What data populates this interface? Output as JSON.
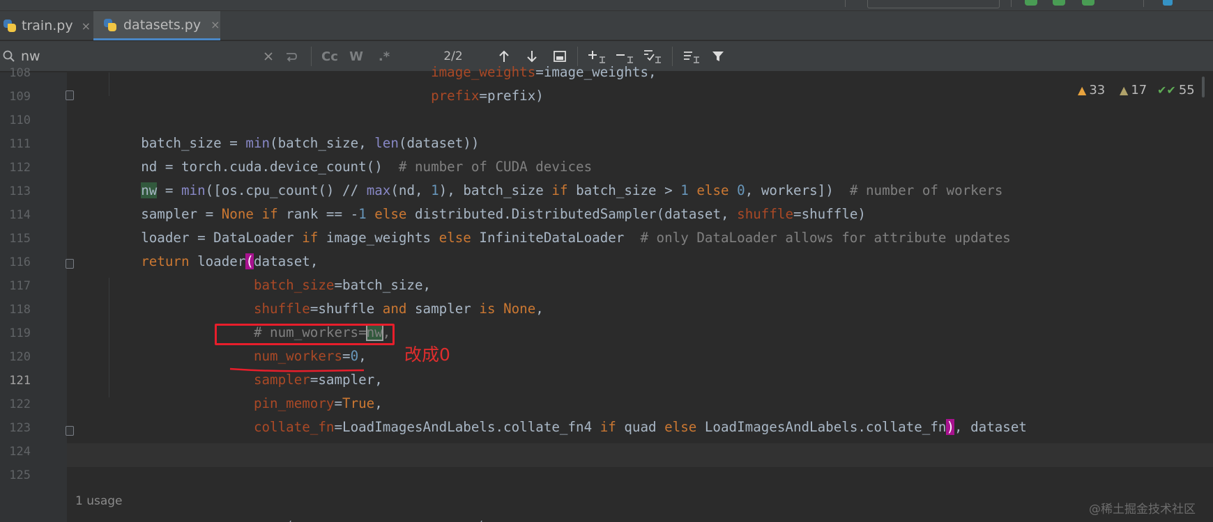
{
  "tabs": [
    {
      "label": "train.py",
      "close": "×"
    },
    {
      "label": "datasets.py",
      "close": "×"
    }
  ],
  "find": {
    "query": "nw",
    "match_count": "2/2",
    "opt_case": "Cc",
    "opt_words": "W",
    "opt_regex": ".*"
  },
  "inspections": {
    "warnings": "33",
    "weak_warnings": "17",
    "typos": "55"
  },
  "editor": {
    "current_line": 121,
    "lines": [
      {
        "n": "108",
        "tokens": [
          {
            "t": "                                        "
          },
          {
            "t": "image_weights",
            "c": "pm"
          },
          {
            "t": "=image_weights,"
          }
        ]
      },
      {
        "n": "109",
        "tokens": [
          {
            "t": "                                        "
          },
          {
            "t": "prefix",
            "c": "pm"
          },
          {
            "t": "=prefix)"
          }
        ]
      },
      {
        "n": "110",
        "tokens": []
      },
      {
        "n": "111",
        "tokens": [
          {
            "t": "    batch_size = "
          },
          {
            "t": "min",
            "c": "fn"
          },
          {
            "t": "(batch_size, "
          },
          {
            "t": "len",
            "c": "fn"
          },
          {
            "t": "(dataset))"
          }
        ]
      },
      {
        "n": "112",
        "tokens": [
          {
            "t": "    nd = torch.cuda.device_count()  "
          },
          {
            "t": "# number of CUDA devices",
            "c": "cm"
          }
        ]
      },
      {
        "n": "113",
        "tokens": [
          {
            "t": "    "
          },
          {
            "t": "nw",
            "c": "occ"
          },
          {
            "t": " = "
          },
          {
            "t": "min",
            "c": "fn"
          },
          {
            "t": "([os.cpu_count() // "
          },
          {
            "t": "max",
            "c": "fn"
          },
          {
            "t": "(nd, "
          },
          {
            "t": "1",
            "c": "num"
          },
          {
            "t": "), batch_size "
          },
          {
            "t": "if",
            "c": "kw"
          },
          {
            "t": " batch_size > "
          },
          {
            "t": "1",
            "c": "num"
          },
          {
            "t": " "
          },
          {
            "t": "else",
            "c": "kw"
          },
          {
            "t": " "
          },
          {
            "t": "0",
            "c": "num"
          },
          {
            "t": ", workers])  "
          },
          {
            "t": "# number of workers",
            "c": "cm"
          }
        ]
      },
      {
        "n": "114",
        "tokens": [
          {
            "t": "    sampler = "
          },
          {
            "t": "None",
            "c": "kw"
          },
          {
            "t": " "
          },
          {
            "t": "if",
            "c": "kw"
          },
          {
            "t": " rank == -"
          },
          {
            "t": "1",
            "c": "num"
          },
          {
            "t": " "
          },
          {
            "t": "else",
            "c": "kw"
          },
          {
            "t": " distributed.DistributedSampler(dataset, "
          },
          {
            "t": "shuffle",
            "c": "pm"
          },
          {
            "t": "=shuffle)"
          }
        ]
      },
      {
        "n": "115",
        "tokens": [
          {
            "t": "    loader = DataLoader "
          },
          {
            "t": "if",
            "c": "kw"
          },
          {
            "t": " image_weights "
          },
          {
            "t": "else",
            "c": "kw"
          },
          {
            "t": " InfiniteDataLoader  "
          },
          {
            "t": "# only DataLoader allows for attribute updates",
            "c": "cm"
          }
        ]
      },
      {
        "n": "116",
        "tokens": [
          {
            "t": "    "
          },
          {
            "t": "return",
            "c": "kw"
          },
          {
            "t": " loader"
          },
          {
            "t": "(",
            "c": "brace"
          },
          {
            "t": "dataset,"
          }
        ]
      },
      {
        "n": "117",
        "tokens": [
          {
            "t": "                  "
          },
          {
            "t": "batch_size",
            "c": "pm"
          },
          {
            "t": "=batch_size,"
          }
        ]
      },
      {
        "n": "118",
        "tokens": [
          {
            "t": "                  "
          },
          {
            "t": "shuffle",
            "c": "pm"
          },
          {
            "t": "=shuffle "
          },
          {
            "t": "and",
            "c": "kw"
          },
          {
            "t": " sampler "
          },
          {
            "t": "is",
            "c": "kw"
          },
          {
            "t": " "
          },
          {
            "t": "None",
            "c": "kw"
          },
          {
            "t": ","
          }
        ]
      },
      {
        "n": "119",
        "tokens": [
          {
            "t": "                  "
          },
          {
            "t": "# num_workers=",
            "c": "cm"
          },
          {
            "t": "nw",
            "c": "cm occ-box"
          },
          {
            "t": ",",
            "c": "cm"
          }
        ]
      },
      {
        "n": "120",
        "tokens": [
          {
            "t": "                  "
          },
          {
            "t": "num_workers",
            "c": "pm"
          },
          {
            "t": "="
          },
          {
            "t": "0",
            "c": "num"
          },
          {
            "t": ","
          }
        ]
      },
      {
        "n": "121",
        "tokens": [
          {
            "t": "                  "
          },
          {
            "t": "sampler",
            "c": "pm"
          },
          {
            "t": "=sampler,"
          }
        ]
      },
      {
        "n": "122",
        "tokens": [
          {
            "t": "                  "
          },
          {
            "t": "pin_memory",
            "c": "pm"
          },
          {
            "t": "="
          },
          {
            "t": "True",
            "c": "kw"
          },
          {
            "t": ","
          }
        ]
      },
      {
        "n": "123",
        "tokens": [
          {
            "t": "                  "
          },
          {
            "t": "collate_fn",
            "c": "pm"
          },
          {
            "t": "=LoadImagesAndLabels.collate_fn4 "
          },
          {
            "t": "if",
            "c": "kw"
          },
          {
            "t": " quad "
          },
          {
            "t": "else",
            "c": "kw"
          },
          {
            "t": " LoadImagesAndLabels.collate_fn"
          },
          {
            "t": ")",
            "c": "brace"
          },
          {
            "t": ", dataset"
          }
        ]
      },
      {
        "n": "124",
        "tokens": []
      },
      {
        "n": "125",
        "tokens": []
      }
    ],
    "usage_hint": "1 usage"
  },
  "annotation": {
    "note": "改成0",
    "color": "#e81e2b"
  },
  "watermark": "@稀土掘金技术社区",
  "colors": {
    "background": "#2b2b2b",
    "keyword": "#cc7832",
    "builtin": "#8888c6",
    "number": "#6897bb",
    "comment": "#808080",
    "parameter": "#aa4926",
    "identifier": "#a9b7c6"
  }
}
